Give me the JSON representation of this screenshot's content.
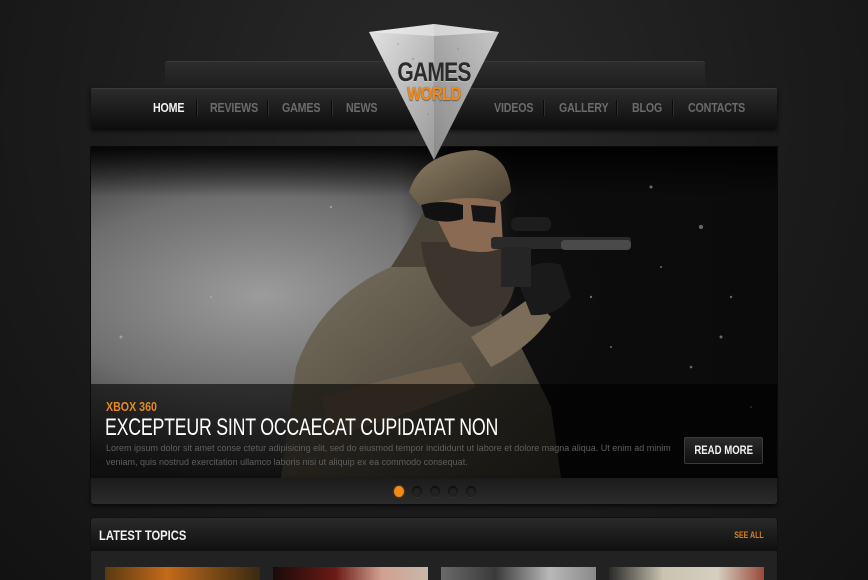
{
  "logo": {
    "line1": "GAMES",
    "line2": "WORLD",
    "accent_color": "#f08a1a"
  },
  "nav": {
    "items": [
      {
        "label": "HOME",
        "active": true
      },
      {
        "label": "REVIEWS",
        "active": false
      },
      {
        "label": "GAMES",
        "active": false
      },
      {
        "label": "NEWS",
        "active": false
      },
      {
        "label": "VIDEOS",
        "active": false
      },
      {
        "label": "GALLERY",
        "active": false
      },
      {
        "label": "BLOG",
        "active": false
      },
      {
        "label": "CONTACTS",
        "active": false
      }
    ]
  },
  "slider": {
    "category": "XBOX 360",
    "title": "EXCEPTEUR SINT OCCAECAT CUPIDATAT NON",
    "text": "Lorem ipsum dolor sit amet conse ctetur adipisicing elit, sed do eiusmod tempor incididunt ut labore et dolore magna aliqua. Ut enim ad minim veniam, quis nostrud exercitation ullamco laboris nisi ut aliquip ex ea commodo consequat.",
    "button_label": "READ MORE",
    "slide_count": 5,
    "active_slide": 1,
    "image": "soldier-with-rifle"
  },
  "latest_topics": {
    "title": "LATEST TOPICS",
    "see_all_label": "SEE ALL",
    "thumbnails": [
      "fiery-battle-scene",
      "red-haired-warrior",
      "armored-mech-soldier",
      "warrior-duo"
    ]
  }
}
